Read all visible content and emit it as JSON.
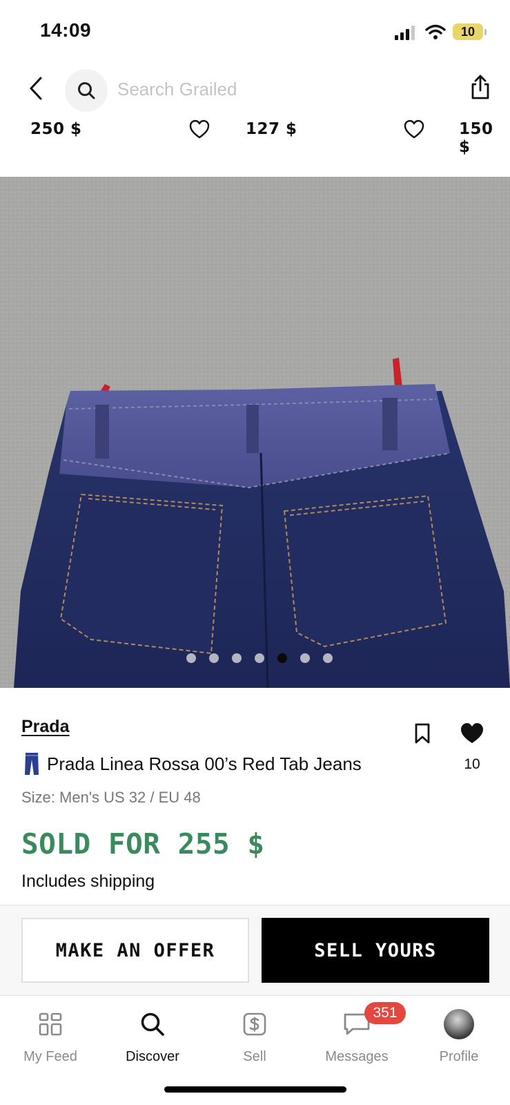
{
  "status_bar": {
    "time": "14:09",
    "battery": "10"
  },
  "header": {
    "search_placeholder": "Search Grailed"
  },
  "price_strip": [
    "250 $",
    "127 $",
    "150 $"
  ],
  "carousel": {
    "count": 7,
    "active_index": 4
  },
  "listing": {
    "brand": "Prada",
    "title": "Prada Linea Rossa 00’s Red Tab Jeans",
    "size": "Size: Men's US 32 / EU 48",
    "likes": "10",
    "sold_label": "SOLD FOR 255 $",
    "shipping": "Includes shipping"
  },
  "actions": {
    "offer": "MAKE AN OFFER",
    "sell": "SELL YOURS"
  },
  "tabs": [
    {
      "label": "My Feed",
      "icon": "feed-grid-icon"
    },
    {
      "label": "Discover",
      "icon": "search-icon"
    },
    {
      "label": "Sell",
      "icon": "sell-dollar-icon"
    },
    {
      "label": "Messages",
      "icon": "chat-bubble-icon"
    },
    {
      "label": "Profile",
      "icon": "avatar"
    }
  ],
  "messages_badge": "351",
  "colors": {
    "sold_green": "#3a8a5e",
    "badge_red": "#e4473d",
    "battery_yellow": "#e9d66b"
  }
}
